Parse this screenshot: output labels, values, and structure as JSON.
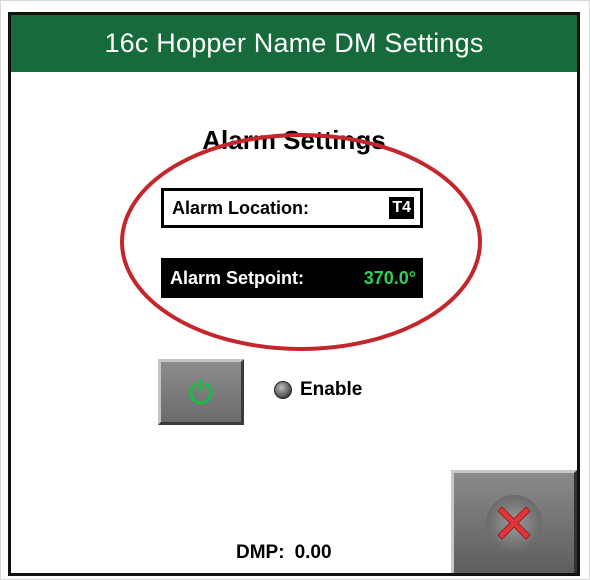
{
  "header": {
    "title": "16c Hopper Name DM Settings"
  },
  "section": {
    "title": "Alarm Settings"
  },
  "alarm_location": {
    "label": "Alarm Location:",
    "value": "T4"
  },
  "alarm_setpoint": {
    "label": "Alarm Setpoint:",
    "value": "370.0°"
  },
  "enable": {
    "label": "Enable",
    "state": "off"
  },
  "dmp": {
    "label": "DMP:",
    "value": "0.00"
  },
  "colors": {
    "header_bg": "#176a3c",
    "setpoint_value": "#2bd05a",
    "highlight_ellipse": "#c4272b",
    "power_icon": "#1fb84a",
    "close_icon": "#e0353a"
  },
  "icons": {
    "power": "power-icon",
    "close": "close-icon",
    "indicator": "status-indicator"
  }
}
